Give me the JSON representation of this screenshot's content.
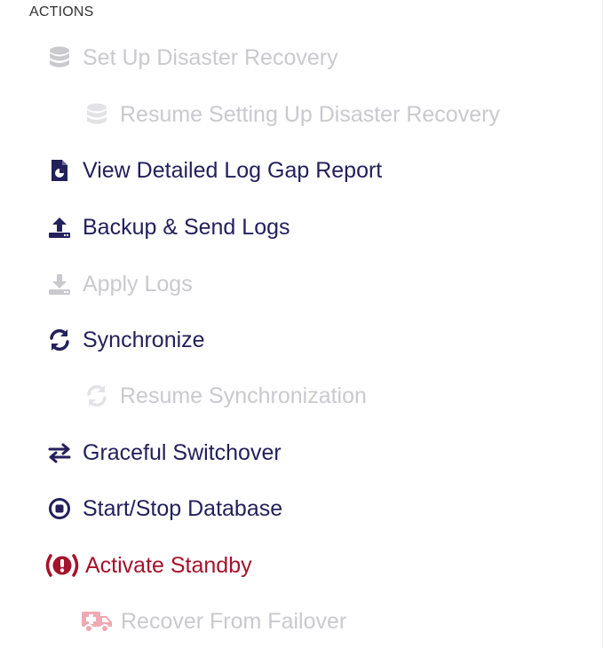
{
  "section_title": "ACTIONS",
  "colors": {
    "enabled": "#23205c",
    "disabled": "#c9c9ce",
    "danger": "#a5122a",
    "danger_disabled_icon": "#f0a9b2"
  },
  "actions": [
    {
      "label": "Set Up Disaster Recovery",
      "icon": "database-icon",
      "state": "disabled"
    },
    {
      "label": "Resume Setting Up Disaster Recovery",
      "icon": "database-icon",
      "state": "disabled"
    },
    {
      "label": "View Detailed Log Gap Report",
      "icon": "report-icon",
      "state": "enabled"
    },
    {
      "label": "Backup & Send Logs",
      "icon": "upload-icon",
      "state": "enabled"
    },
    {
      "label": "Apply Logs",
      "icon": "download-icon",
      "state": "disabled"
    },
    {
      "label": "Synchronize",
      "icon": "sync-icon",
      "state": "enabled"
    },
    {
      "label": "Resume Synchronization",
      "icon": "sync-icon",
      "state": "disabled"
    },
    {
      "label": "Graceful Switchover",
      "icon": "switch-arrows-icon",
      "state": "enabled"
    },
    {
      "label": "Start/Stop Database",
      "icon": "stop-circle-icon",
      "state": "enabled"
    },
    {
      "label": "Activate Standby",
      "icon": "alert-icon",
      "state": "danger"
    },
    {
      "label": "Recover From Failover",
      "icon": "ambulance-icon",
      "state": "disabled"
    }
  ]
}
